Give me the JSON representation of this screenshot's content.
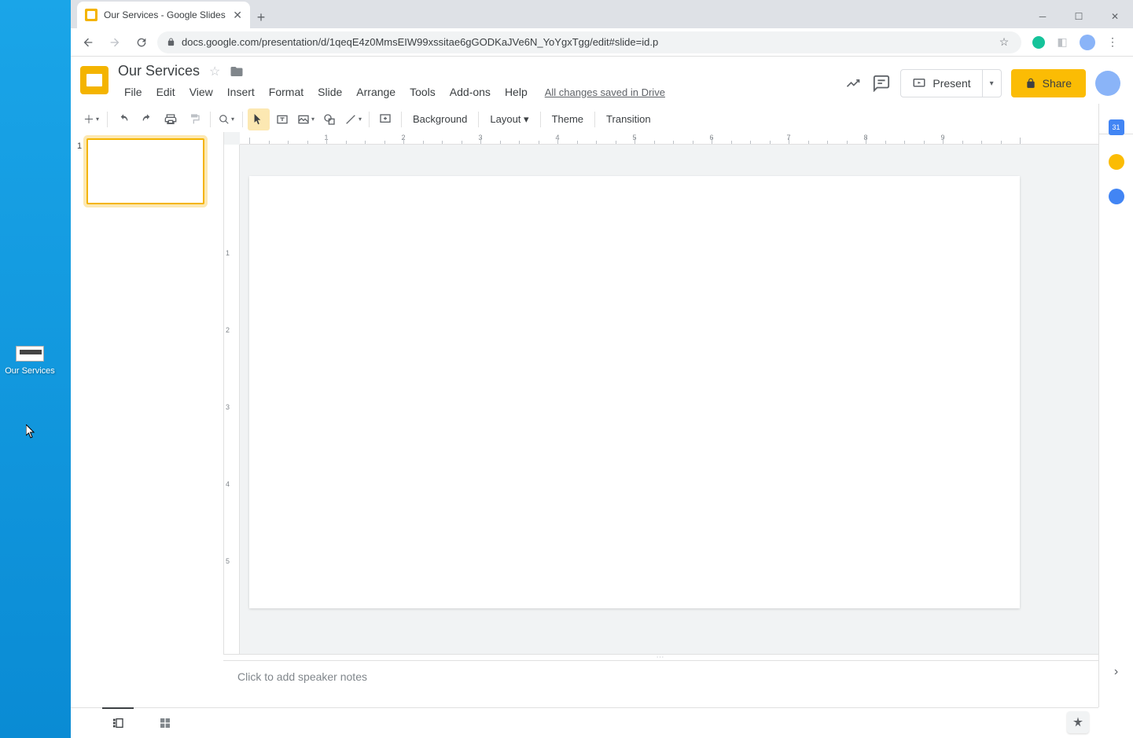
{
  "desktop": {
    "icon_label": "Our Services"
  },
  "browser": {
    "tab_title": "Our Services - Google Slides",
    "url": "docs.google.com/presentation/d/1qeqE4z0MmsEIW99xssitae6gGODKaJVe6N_YoYgxTgg/edit#slide=id.p"
  },
  "doc": {
    "title": "Our Services",
    "save_status": "All changes saved in Drive"
  },
  "menus": {
    "file": "File",
    "edit": "Edit",
    "view": "View",
    "insert": "Insert",
    "format": "Format",
    "slide": "Slide",
    "arrange": "Arrange",
    "tools": "Tools",
    "addons": "Add-ons",
    "help": "Help"
  },
  "toolbar": {
    "background": "Background",
    "layout": "Layout",
    "theme": "Theme",
    "transition": "Transition"
  },
  "actions": {
    "present": "Present",
    "share": "Share"
  },
  "thumbnails": [
    {
      "num": "1"
    }
  ],
  "ruler_h_labels": [
    "1",
    "2",
    "3",
    "4",
    "5",
    "6",
    "7",
    "8",
    "9"
  ],
  "ruler_v_labels": [
    "1",
    "2",
    "3",
    "4",
    "5"
  ],
  "speaker_notes_placeholder": "Click to add speaker notes",
  "side_calendar_day": "31"
}
